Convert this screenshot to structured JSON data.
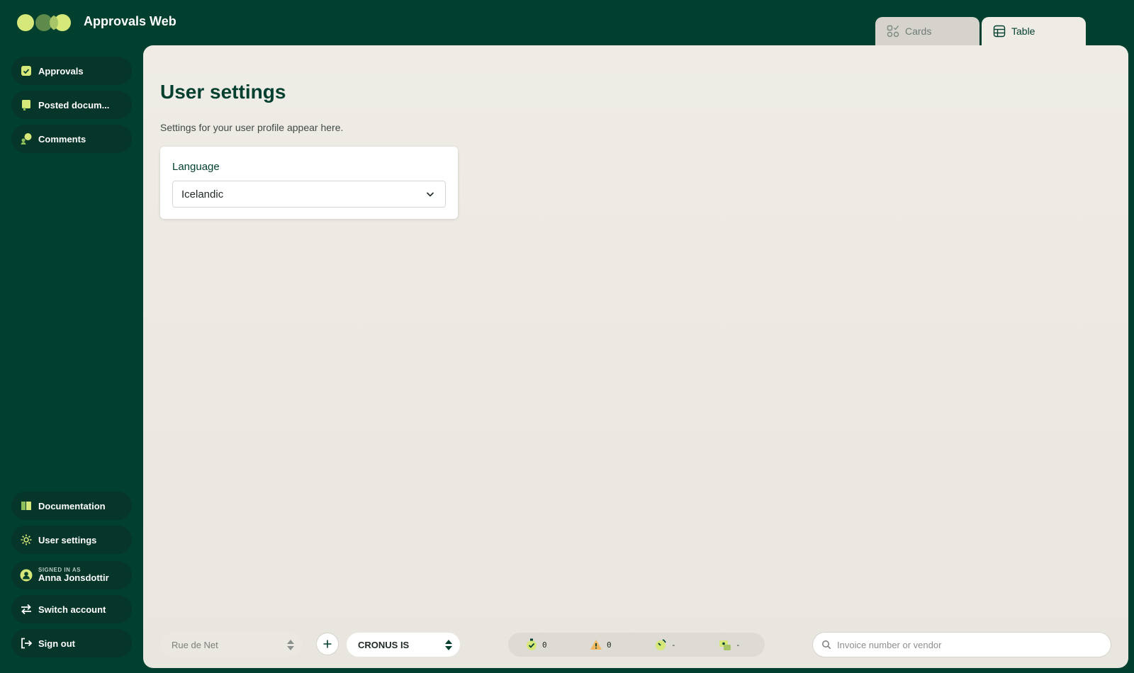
{
  "app": {
    "title": "Approvals Web"
  },
  "view_tabs": [
    {
      "label": "Cards",
      "icon": "cards-icon",
      "active": false
    },
    {
      "label": "Table",
      "icon": "table-icon",
      "active": true
    }
  ],
  "sidebar": {
    "top_items": [
      {
        "label": "Approvals",
        "icon": "approval-check-icon"
      },
      {
        "label": "Posted docum...",
        "icon": "document-icon"
      },
      {
        "label": "Comments",
        "icon": "comments-icon"
      }
    ],
    "bottom_items": [
      {
        "label": "Documentation",
        "icon": "book-icon"
      },
      {
        "label": "User settings",
        "icon": "gear-icon"
      }
    ],
    "signed_in": {
      "label": "SIGNED IN AS",
      "name": "Anna Jonsdottir",
      "icon": "user-avatar-icon"
    },
    "switch_account": {
      "label": "Switch account",
      "icon": "switch-arrows-icon"
    },
    "sign_out": {
      "label": "Sign out",
      "icon": "sign-out-icon"
    }
  },
  "main": {
    "title": "User settings",
    "subtitle": "Settings for your user profile appear here.",
    "language": {
      "label": "Language",
      "value": "Icelandic"
    }
  },
  "bottom_bar": {
    "vendor_select": "Rue de Net",
    "company_select": "CRONUS IS",
    "status": [
      {
        "icon": "approved-icon",
        "value": "0"
      },
      {
        "icon": "warning-icon",
        "value": "0"
      },
      {
        "icon": "clock-icon",
        "value": "-"
      },
      {
        "icon": "money-icon",
        "value": "-"
      }
    ],
    "search_placeholder": "Invoice number or vendor"
  },
  "colors": {
    "brand_dark": "#013f2f",
    "sidebar_pill": "#06352a",
    "accent_lime": "#d6e87a",
    "panel_bg": "#efece6"
  }
}
